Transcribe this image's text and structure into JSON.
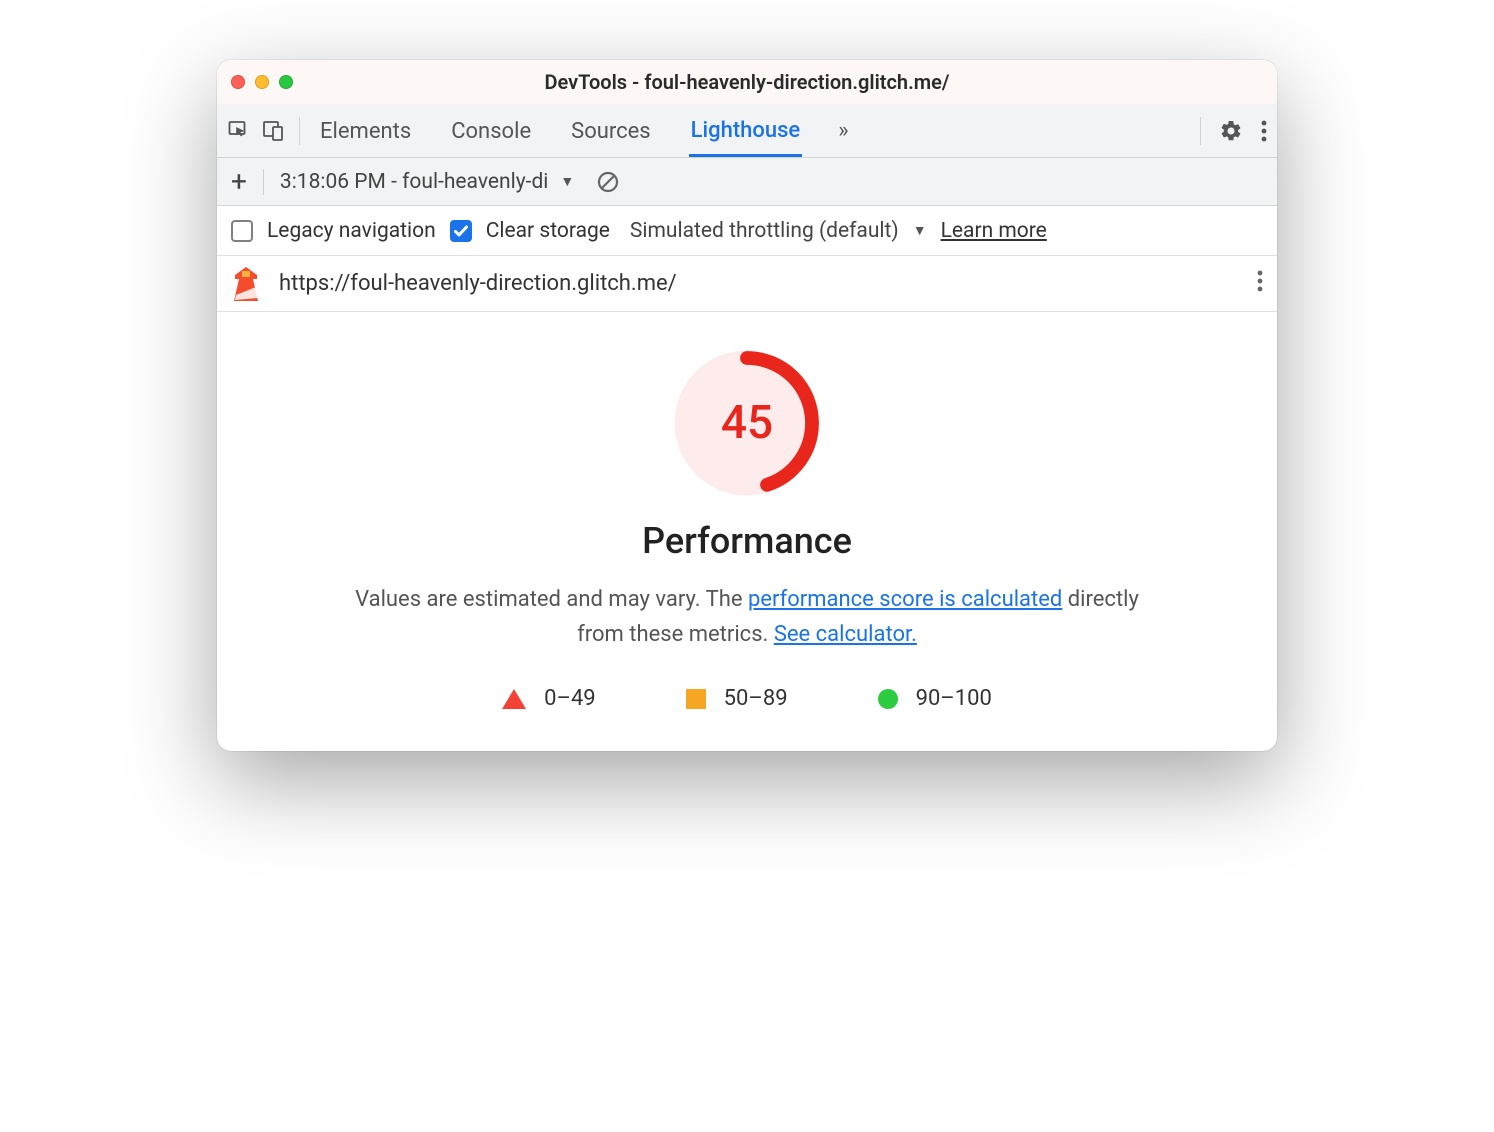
{
  "titlebar": {
    "title": "DevTools - foul-heavenly-direction.glitch.me/"
  },
  "tabs": {
    "elements": "Elements",
    "console": "Console",
    "sources": "Sources",
    "lighthouse": "Lighthouse"
  },
  "sub_row": {
    "report_label": "3:18:06 PM - foul-heavenly-di"
  },
  "opts": {
    "legacy_label": "Legacy navigation",
    "clear_label": "Clear storage",
    "throttle_label": "Simulated throttling (default)",
    "learn_more": "Learn more"
  },
  "report": {
    "url": "https://foul-heavenly-direction.glitch.me/"
  },
  "perf": {
    "score": "45",
    "title": "Performance",
    "desc_prefix": "Values are estimated and may vary. The ",
    "link1": "performance score is calculated",
    "desc_mid": " directly from these metrics. ",
    "link2": "See calculator."
  },
  "legend": {
    "low": "0–49",
    "mid": "50–89",
    "high": "90–100"
  }
}
